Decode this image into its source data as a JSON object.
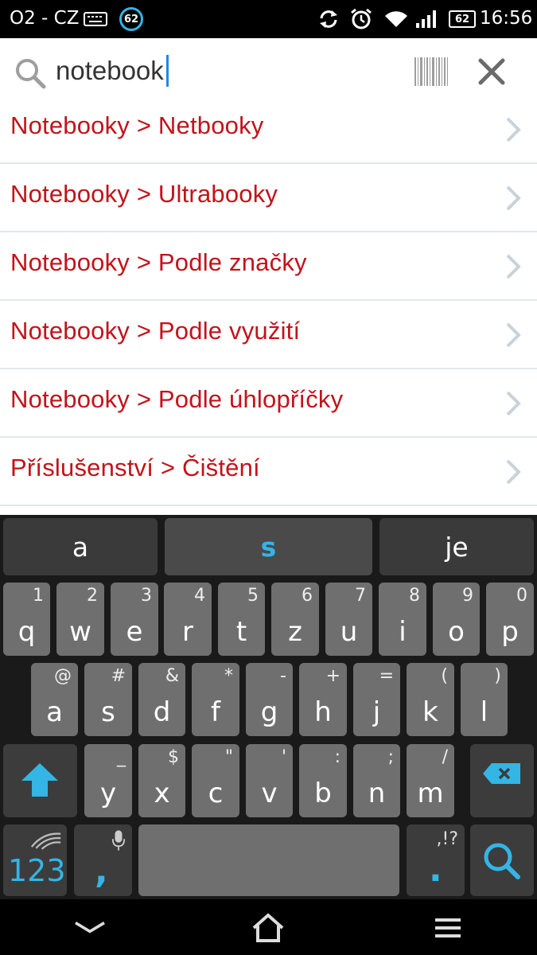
{
  "status_bar": {
    "carrier": "O2 - CZ",
    "notification_badge": "62",
    "battery_level": "62",
    "time": "16:56"
  },
  "search": {
    "query": "notebook"
  },
  "suggestions": [
    {
      "label": "Notebooky > Netbooky"
    },
    {
      "label": "Notebooky > Ultrabooky"
    },
    {
      "label": "Notebooky > Podle značky"
    },
    {
      "label": "Notebooky > Podle využití"
    },
    {
      "label": "Notebooky > Podle úhlopříčky"
    },
    {
      "label": "Příslušenství > Čištění"
    }
  ],
  "keyboard": {
    "predictions": [
      "a",
      "s",
      "je"
    ],
    "row1": [
      {
        "key": "q",
        "alt": "1"
      },
      {
        "key": "w",
        "alt": "2"
      },
      {
        "key": "e",
        "alt": "3"
      },
      {
        "key": "r",
        "alt": "4"
      },
      {
        "key": "t",
        "alt": "5"
      },
      {
        "key": "z",
        "alt": "6"
      },
      {
        "key": "u",
        "alt": "7"
      },
      {
        "key": "i",
        "alt": "8"
      },
      {
        "key": "o",
        "alt": "9"
      },
      {
        "key": "p",
        "alt": "0"
      }
    ],
    "row2": [
      {
        "key": "a",
        "alt": "@"
      },
      {
        "key": "s",
        "alt": "#"
      },
      {
        "key": "d",
        "alt": "&"
      },
      {
        "key": "f",
        "alt": "*"
      },
      {
        "key": "g",
        "alt": "-"
      },
      {
        "key": "h",
        "alt": "+"
      },
      {
        "key": "j",
        "alt": "="
      },
      {
        "key": "k",
        "alt": "("
      },
      {
        "key": "l",
        "alt": ")"
      }
    ],
    "row3": [
      {
        "key": "y",
        "alt": "_"
      },
      {
        "key": "x",
        "alt": "$"
      },
      {
        "key": "c",
        "alt": "\""
      },
      {
        "key": "v",
        "alt": "'"
      },
      {
        "key": "b",
        "alt": ":"
      },
      {
        "key": "n",
        "alt": ";"
      },
      {
        "key": "m",
        "alt": "/"
      }
    ],
    "numbers_label": "123",
    "comma_label": ",",
    "period_label": ".",
    "period_alt": ",!?"
  },
  "colors": {
    "accent": "#33b5e5",
    "suggestion_text": "#c4121a"
  }
}
